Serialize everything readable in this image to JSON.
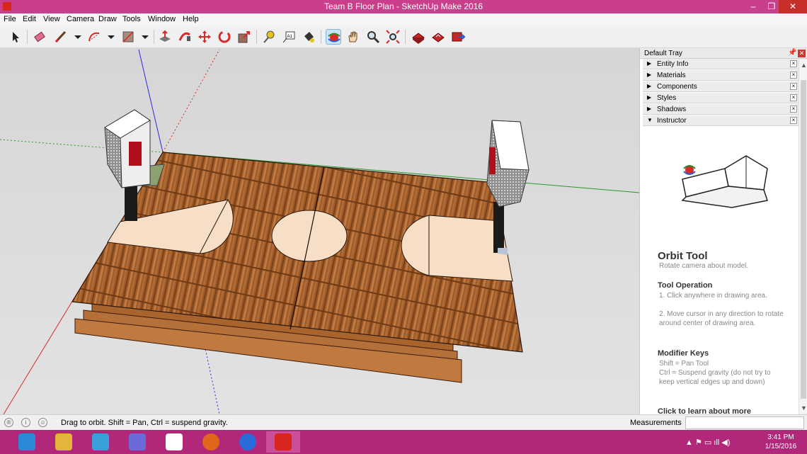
{
  "window": {
    "title": "Team B Floor Plan - SketchUp Make 2016"
  },
  "menu": [
    "File",
    "Edit",
    "View",
    "Camera",
    "Draw",
    "Tools",
    "Window",
    "Help"
  ],
  "tray": {
    "title": "Default Tray",
    "panels": [
      {
        "label": "Entity Info",
        "expanded": false
      },
      {
        "label": "Materials",
        "expanded": false
      },
      {
        "label": "Components",
        "expanded": false
      },
      {
        "label": "Styles",
        "expanded": false
      },
      {
        "label": "Shadows",
        "expanded": false
      },
      {
        "label": "Instructor",
        "expanded": true
      }
    ],
    "instructor": {
      "tool_name": "Orbit Tool",
      "tool_desc": "Rotate camera about model.",
      "operation_heading": "Tool Operation",
      "operation_steps": [
        "1.  Click anywhere in drawing area.",
        "2.  Move cursor in any direction to rotate around center of drawing area."
      ],
      "modifier_heading": "Modifier Keys",
      "modifier_lines": [
        "Shift = Pan Tool",
        "Ctrl = Suspend gravity (do not try to keep vertical edges up and down)"
      ],
      "learn_more": "Click to learn about more"
    }
  },
  "status": {
    "message": "Drag to orbit. Shift = Pan, Ctrl = suspend gravity.",
    "measurements_label": "Measurements",
    "measurements_value": ""
  },
  "clock": {
    "time": "3:41 PM",
    "date": "1/15/2016"
  },
  "colors": {
    "titlebar": "#c93f8b",
    "taskbar": "#b1277a",
    "wood": "#9a5a2a",
    "court_line": "#f5dcc4"
  }
}
